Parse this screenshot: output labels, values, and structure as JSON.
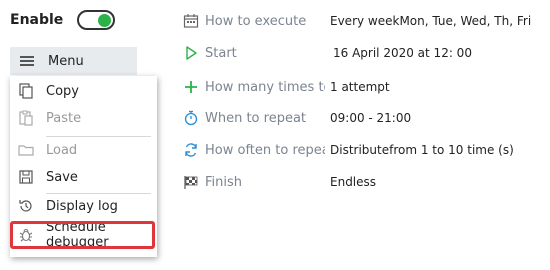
{
  "enable": {
    "label": "Enable",
    "state": "on"
  },
  "menu": {
    "button_label": "Menu",
    "items": [
      {
        "label": "Copy",
        "icon": "copy-icon",
        "enabled": true
      },
      {
        "label": "Paste",
        "icon": "paste-icon",
        "enabled": false
      },
      {
        "label": "Load",
        "icon": "folder-icon",
        "enabled": false
      },
      {
        "label": "Save",
        "icon": "save-icon",
        "enabled": true
      },
      {
        "label": "Display log",
        "icon": "history-icon",
        "enabled": true
      },
      {
        "label": "Schedule debugger",
        "icon": "bug-icon",
        "enabled": true,
        "highlighted": true
      }
    ]
  },
  "settings": [
    {
      "label": "How to execute",
      "value": "Every weekMon, Tue, Wed, Th, Fri",
      "icon": "calendar-icon"
    },
    {
      "label": "Start",
      "value": "16 April 2020 at  12: 00",
      "icon": "play-icon"
    },
    {
      "label": "How many times to re",
      "value": "1 attempt",
      "icon": "plus-icon"
    },
    {
      "label": "When to repeat",
      "value": "09:00 - 21:00",
      "icon": "stopwatch-icon"
    },
    {
      "label": "How often to repeat",
      "value": "Distributefrom 1 to 10 time (s)",
      "icon": "refresh-icon"
    },
    {
      "label": "Finish",
      "value": "Endless",
      "icon": "checkered-flag-icon"
    }
  ],
  "colors": {
    "toggle_on": "#2bb34a",
    "accent": "#2a8fd6",
    "highlight_border": "#e0353b",
    "label_gray": "#7b8490"
  }
}
